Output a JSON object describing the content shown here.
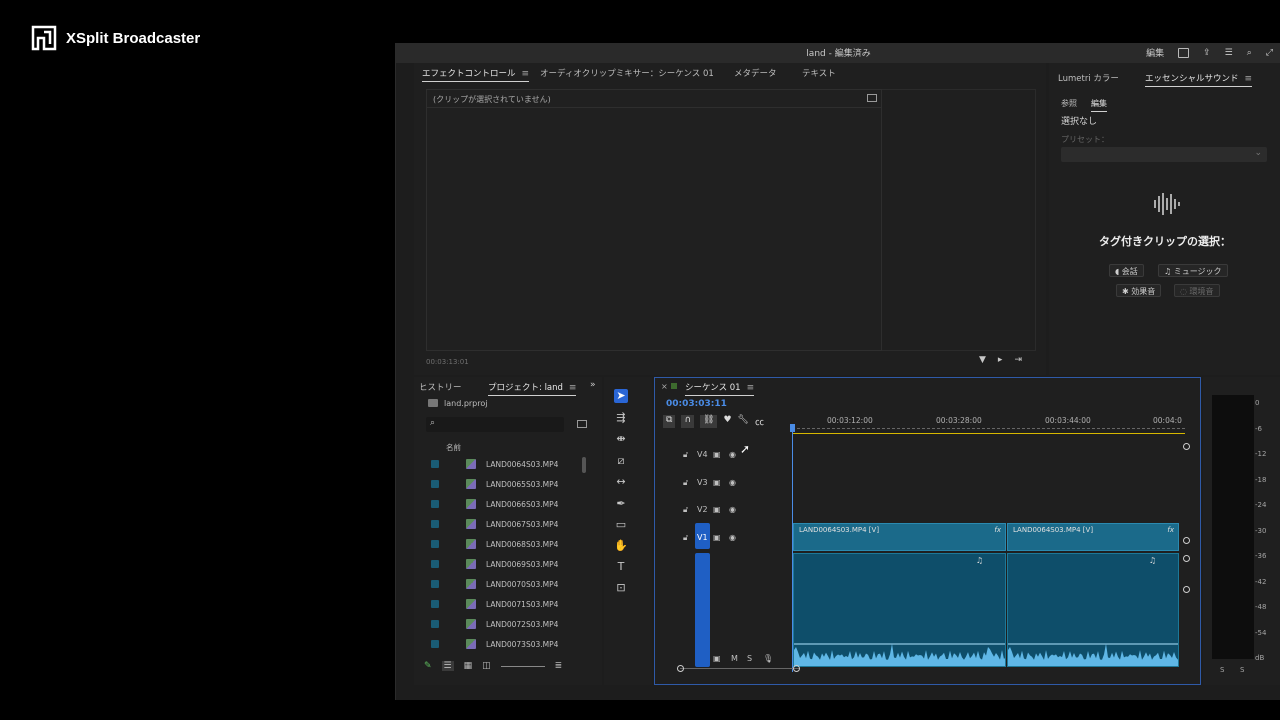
{
  "overlay": {
    "brand": "XSplit Broadcaster"
  },
  "titlebar": {
    "title": "land - 編集済み",
    "workspace_label": "編集"
  },
  "effect_controls": {
    "tabs": [
      {
        "label": "エフェクトコントロール",
        "active": true
      },
      {
        "label": "オーディオクリップミキサー：シーケンス 01",
        "active": false
      },
      {
        "label": "メタデータ",
        "active": false
      },
      {
        "label": "テキスト",
        "active": false
      }
    ],
    "empty_message": "(クリップが選択されていません)",
    "timecode": "00:03:13:01"
  },
  "essential_sound": {
    "tabs": [
      {
        "label": "Lumetri カラー",
        "active": false
      },
      {
        "label": "エッセンシャルサウンド",
        "active": true
      }
    ],
    "subtabs": [
      {
        "label": "参照",
        "active": false
      },
      {
        "label": "編集",
        "active": true
      }
    ],
    "selection": "選択なし",
    "preset_label": "プリセット：",
    "prompt": "タグ付きクリップの選択：",
    "buttons": [
      {
        "label": "会話",
        "icon": "dialogue-icon"
      },
      {
        "label": "ミュージック",
        "icon": "music-icon"
      },
      {
        "label": "効果音",
        "icon": "sfx-icon"
      },
      {
        "label": "環境音",
        "icon": "ambience-icon"
      }
    ]
  },
  "project": {
    "tabs": [
      {
        "label": "ヒストリー",
        "active": false
      },
      {
        "label": "プロジェクト: land",
        "active": true
      }
    ],
    "file": "land.prproj",
    "column_name": "名前",
    "items": [
      "LAND0064S03.MP4",
      "LAND0065S03.MP4",
      "LAND0066S03.MP4",
      "LAND0067S03.MP4",
      "LAND0068S03.MP4",
      "LAND0069S03.MP4",
      "LAND0070S03.MP4",
      "LAND0071S03.MP4",
      "LAND0072S03.MP4",
      "LAND0073S03.MP4"
    ]
  },
  "timeline": {
    "sequence_name": "シーケンス 01",
    "timecode": "00:03:03:11",
    "ruler": [
      "00:03:12:00",
      "00:03:28:00",
      "00:03:44:00",
      "00:04:0"
    ],
    "tracks": [
      "V4",
      "V3",
      "V2",
      "V1"
    ],
    "audio_controls": [
      "M",
      "S"
    ],
    "clips": [
      "LAND0064S03.MP4 [V]",
      "LAND0064S03.MP4 [V]"
    ],
    "fx_badge": "fx"
  },
  "meters": {
    "scale": [
      "0",
      "-6",
      "-12",
      "-18",
      "-24",
      "-30",
      "-36",
      "-42",
      "-48",
      "-54",
      "dB"
    ],
    "solo_labels": [
      "S",
      "S"
    ]
  },
  "colors": {
    "accent": "#2a66d6",
    "timecode": "#4a8ce6",
    "clip_video": "#1b6a8a",
    "waveform": "#5fb7e6"
  }
}
